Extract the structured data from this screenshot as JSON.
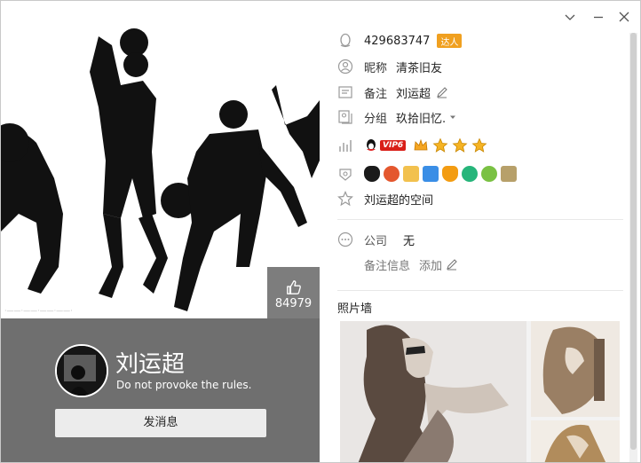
{
  "window_controls": {
    "collapse_icon": "chevron-down-icon",
    "minimize_icon": "minimize-icon",
    "close_icon": "close-icon"
  },
  "cover": {
    "caption": "·——·——·——·——·"
  },
  "likes": {
    "count": "84979",
    "icon": "thumbs-up-icon"
  },
  "profile": {
    "nickname": "刘运超",
    "signature": "Do not provoke the rules.",
    "send_message_label": "发消息"
  },
  "info": {
    "qq_number": "429683747",
    "talent_badge": "达人",
    "nickname_label": "昵称",
    "nickname_value": "清茶旧友",
    "remark_label": "备注",
    "remark_value": "刘运超",
    "group_label": "分组",
    "group_value": "玖拾旧忆.",
    "vip_label": "VIP6",
    "space_link": "刘运超的空间",
    "company_label": "公司",
    "company_value": "无",
    "remark_info_label": "备注信息",
    "remark_info_add": "添加"
  },
  "photo_wall": {
    "title": "照片墙"
  },
  "colors": {
    "panel_gray": "#6f6f6f",
    "like_gray": "#7d7d7d",
    "vip_red": "#d91e18",
    "star_gold": "#f5a623"
  }
}
